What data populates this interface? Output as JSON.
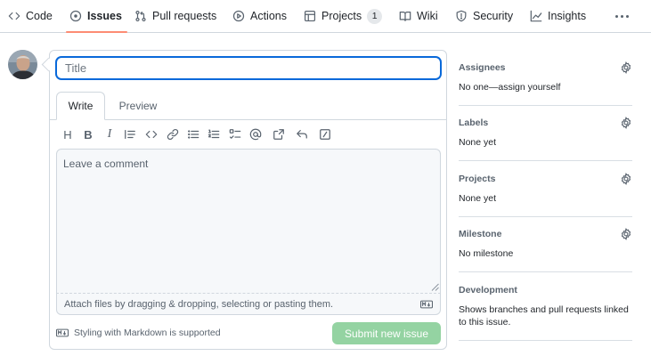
{
  "repo_nav": {
    "items": [
      {
        "label": "Code",
        "icon": "code-icon"
      },
      {
        "label": "Issues",
        "icon": "issue-opened-icon",
        "selected": true
      },
      {
        "label": "Pull requests",
        "icon": "git-pull-request-icon"
      },
      {
        "label": "Actions",
        "icon": "play-icon"
      },
      {
        "label": "Projects",
        "icon": "table-icon",
        "counter": "1"
      },
      {
        "label": "Wiki",
        "icon": "book-icon"
      },
      {
        "label": "Security",
        "icon": "shield-icon"
      },
      {
        "label": "Insights",
        "icon": "graph-icon"
      }
    ],
    "more_icon": "kebab-horizontal-icon"
  },
  "issue_form": {
    "title_placeholder": "Title",
    "tabs": [
      "Write",
      "Preview"
    ],
    "active_tab": "Write",
    "toolbar": [
      "heading-icon",
      "bold-icon",
      "italic-icon",
      "quote-icon",
      "code-icon",
      "link-icon",
      "unordered-list-icon",
      "ordered-list-icon",
      "task-list-icon",
      "mention-icon",
      "cross-reference-icon",
      "reply-icon",
      "slash-command-icon"
    ],
    "comment_placeholder": "Leave a comment",
    "attach_text": "Attach files by dragging & dropping, selecting or pasting them.",
    "markdown_note": "Styling with Markdown is supported",
    "submit_label": "Submit new issue"
  },
  "sidebar": {
    "assignees": {
      "heading": "Assignees",
      "value": "No one—assign yourself"
    },
    "labels": {
      "heading": "Labels",
      "value": "None yet"
    },
    "projects": {
      "heading": "Projects",
      "value": "None yet"
    },
    "milestone": {
      "heading": "Milestone",
      "value": "No milestone"
    },
    "development": {
      "heading": "Development",
      "value": "Shows branches and pull requests linked to this issue."
    }
  },
  "colors": {
    "accent_blue": "#0969da",
    "selected_underline": "#fd8c73",
    "submit_disabled_green": "#94d3a2",
    "border": "#d0d7de",
    "muted_text": "#59636e"
  }
}
